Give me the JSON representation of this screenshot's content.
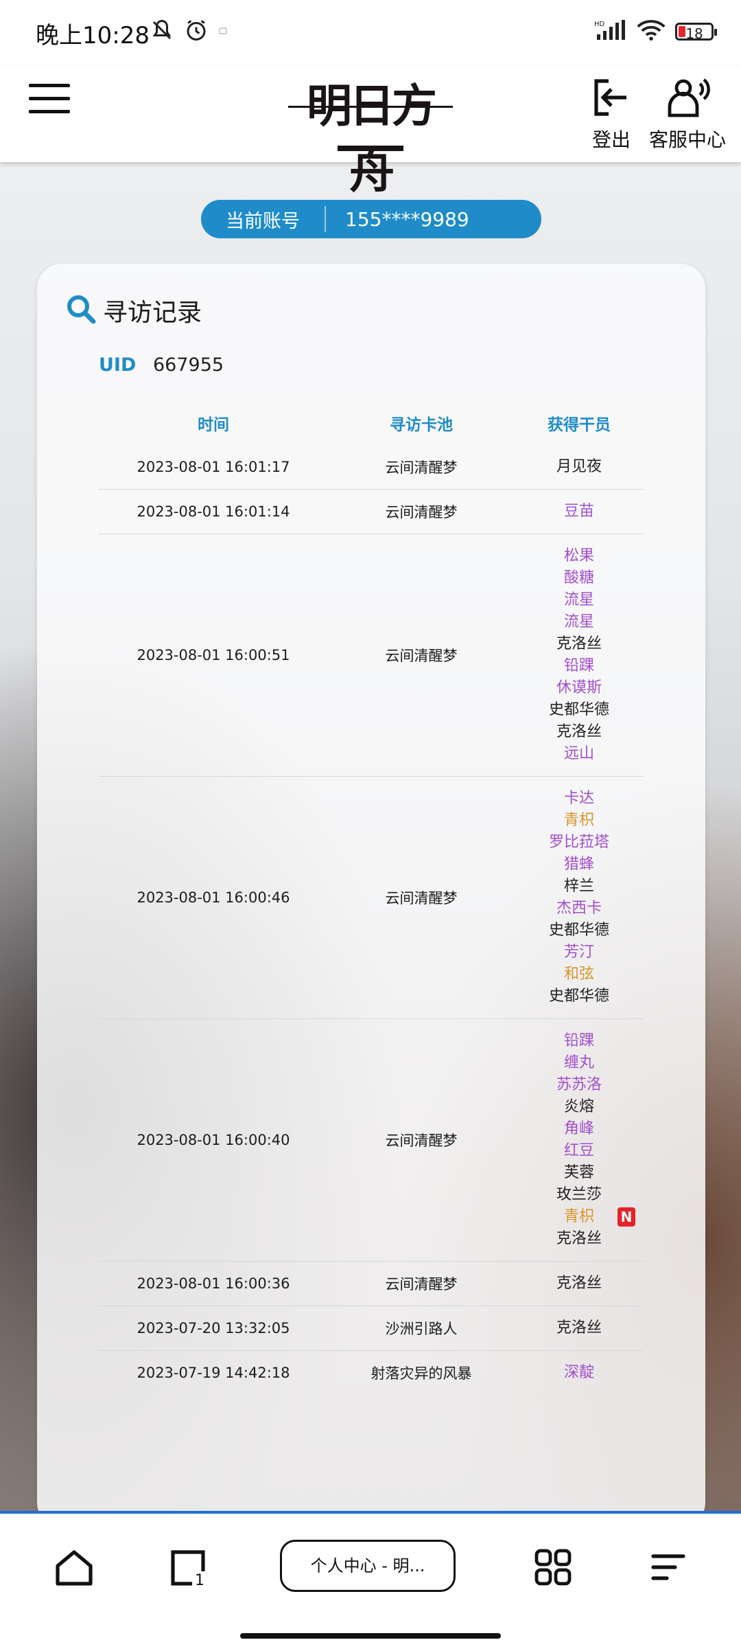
{
  "status_bar": {
    "time": "晚上10:28",
    "network_label": "HD",
    "battery": "18"
  },
  "header": {
    "logo_text": "明日方舟",
    "logout_label": "登出",
    "service_label": "客服中心"
  },
  "account": {
    "label": "当前账号",
    "value": "155****9989"
  },
  "card": {
    "title": "寻访记录",
    "uid_label": "UID",
    "uid_value": "667955"
  },
  "table": {
    "headers": {
      "time": "时间",
      "pool": "寻访卡池",
      "operators": "获得干员"
    },
    "rows": [
      {
        "time": "2023-08-01 16:01:17",
        "pool": "云间清醒梦",
        "operators": [
          {
            "name": "月见夜",
            "rarity": 3
          }
        ]
      },
      {
        "time": "2023-08-01 16:01:14",
        "pool": "云间清醒梦",
        "operators": [
          {
            "name": "豆苗",
            "rarity": 4
          }
        ]
      },
      {
        "time": "2023-08-01 16:00:51",
        "pool": "云间清醒梦",
        "operators": [
          {
            "name": "松果",
            "rarity": 4
          },
          {
            "name": "酸糖",
            "rarity": 4
          },
          {
            "name": "流星",
            "rarity": 4
          },
          {
            "name": "流星",
            "rarity": 4
          },
          {
            "name": "克洛丝",
            "rarity": 3
          },
          {
            "name": "铅踝",
            "rarity": 4
          },
          {
            "name": "休谟斯",
            "rarity": 4
          },
          {
            "name": "史都华德",
            "rarity": 3
          },
          {
            "name": "克洛丝",
            "rarity": 3
          },
          {
            "name": "远山",
            "rarity": 4
          }
        ]
      },
      {
        "time": "2023-08-01 16:00:46",
        "pool": "云间清醒梦",
        "operators": [
          {
            "name": "卡达",
            "rarity": 4
          },
          {
            "name": "青枳",
            "rarity": 5
          },
          {
            "name": "罗比菈塔",
            "rarity": 4
          },
          {
            "name": "猎蜂",
            "rarity": 4
          },
          {
            "name": "梓兰",
            "rarity": 3
          },
          {
            "name": "杰西卡",
            "rarity": 4
          },
          {
            "name": "史都华德",
            "rarity": 3
          },
          {
            "name": "芳汀",
            "rarity": 4
          },
          {
            "name": "和弦",
            "rarity": 5
          },
          {
            "name": "史都华德",
            "rarity": 3
          }
        ]
      },
      {
        "time": "2023-08-01 16:00:40",
        "pool": "云间清醒梦",
        "operators": [
          {
            "name": "铅踝",
            "rarity": 4
          },
          {
            "name": "缠丸",
            "rarity": 4
          },
          {
            "name": "苏苏洛",
            "rarity": 4
          },
          {
            "name": "炎熔",
            "rarity": 3
          },
          {
            "name": "角峰",
            "rarity": 4
          },
          {
            "name": "红豆",
            "rarity": 4
          },
          {
            "name": "芙蓉",
            "rarity": 3
          },
          {
            "name": "玫兰莎",
            "rarity": 3
          },
          {
            "name": "青枳",
            "rarity": 5,
            "new": "N"
          },
          {
            "name": "克洛丝",
            "rarity": 3
          }
        ]
      },
      {
        "time": "2023-08-01 16:00:36",
        "pool": "云间清醒梦",
        "operators": [
          {
            "name": "克洛丝",
            "rarity": 3
          }
        ]
      },
      {
        "time": "2023-07-20 13:32:05",
        "pool": "沙洲引路人",
        "operators": [
          {
            "name": "克洛丝",
            "rarity": 3
          }
        ]
      },
      {
        "time": "2023-07-19 14:42:18",
        "pool": "射落灾异的风暴",
        "operators": [
          {
            "name": "深靛",
            "rarity": 4
          }
        ]
      }
    ]
  },
  "bottom_nav": {
    "current_tab_label": "个人中心 - 明..."
  },
  "colors": {
    "accent": "#1f8cc9",
    "rarity3": "#222222",
    "rarity4": "#a34fcc",
    "rarity5": "#d7962a",
    "new_badge": "#e2242b"
  }
}
